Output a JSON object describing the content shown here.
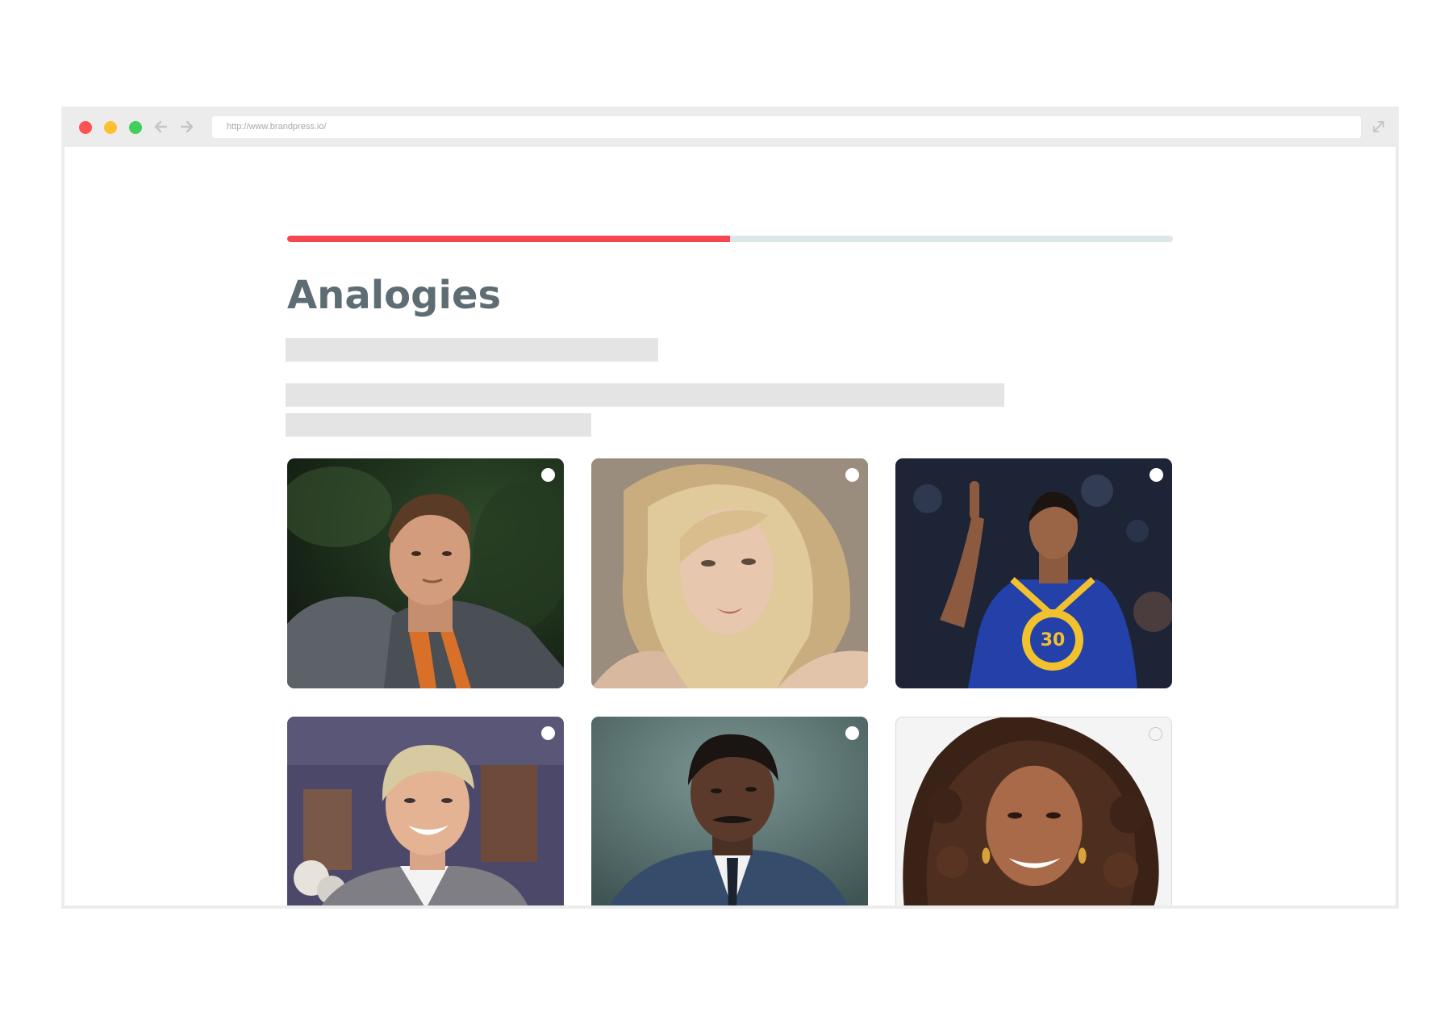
{
  "browser": {
    "url": "http://www.brandpress.io/",
    "icons": {
      "close": "red-dot-icon",
      "minimize": "yellow-dot-icon",
      "maximize": "green-dot-icon",
      "back": "arrow-left-icon",
      "forward": "arrow-right-icon",
      "expand": "expand-icon"
    }
  },
  "page": {
    "progress_fraction": 0.5,
    "title": "Analogies",
    "options": [
      {
        "id": "option-1",
        "image": "man-in-grey-jacket-portrait",
        "selected": false
      },
      {
        "id": "option-2",
        "image": "woman-with-blonde-hair-portrait",
        "selected": false
      },
      {
        "id": "option-3",
        "image": "basketball-player-number-30-portrait",
        "selected": false
      },
      {
        "id": "option-4",
        "image": "smiling-woman-short-hair-portrait",
        "selected": false
      },
      {
        "id": "option-5",
        "image": "man-in-suit-portrait",
        "selected": false
      },
      {
        "id": "option-6",
        "image": "smiling-woman-curly-hair-portrait",
        "selected": false
      }
    ]
  },
  "colors": {
    "progress_fill": "#f4474f",
    "progress_track": "#dde6e9",
    "title": "#5e6d74",
    "skeleton": "#e4e4e4"
  }
}
